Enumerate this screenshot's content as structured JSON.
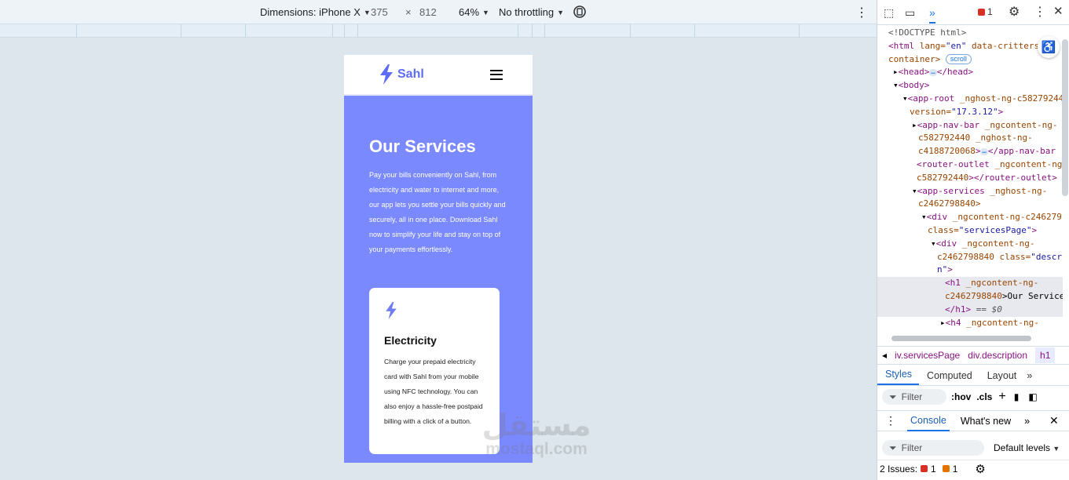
{
  "device_toolbar": {
    "dimensions_label": "Dimensions: iPhone X",
    "width": "375",
    "times": "×",
    "height": "812",
    "zoom": "64%",
    "throttling": "No throttling"
  },
  "app": {
    "brand": "Sahl",
    "hero_title": "Our Services",
    "hero_text": "Pay your bills conveniently on Sahl, from electricity and water to internet and more, our app lets you settle your bills quickly and securely, all in one place. Download Sahl now to simplify your life and stay on top of your payments effortlessly.",
    "card_title": "Electricity",
    "card_text": "Charge your prepaid electricity card with Sahl from your mobile using NFC technology. You can also enjoy a hassle-free postpaid billing with a click of a button."
  },
  "watermark": {
    "arabic": "مستقل",
    "latin": "mostaql.com"
  },
  "devtools": {
    "issues_count": "1",
    "elements": {
      "l1": "<!DOCTYPE html>",
      "l2_tag": "<html",
      "l2_attr": " lang=",
      "l2_val": "\"en\"",
      "l2_attr2": " data-critters-",
      "l3": "container>",
      "l3_pill": "scroll",
      "l4_open": "<head>",
      "l4_close": "</head>",
      "l5": "<body>",
      "l6_tag": "<app-root",
      "l6_attr": " _nghost-ng-c58279244",
      "l7_attr": "version=",
      "l7_val": "\"17.3.12\"",
      "l7_end": ">",
      "l8_tag": "<app-nav-bar",
      "l8_attr": " _ngcontent-ng-",
      "l9": "c582792440 _nghost-ng-",
      "l10_attr": "c4188720068",
      "l10_close": "</app-nav-bar",
      "l11_tag": "<router-outlet",
      "l11_attr": " _ngcontent-ng",
      "l12_attr": "c582792440",
      "l12_close": "></router-outlet>",
      "l13_tag": "<app-services",
      "l13_attr": " _nghost-ng-",
      "l14": "c2462798840>",
      "l15_tag": "<div",
      "l15_attr": " _ngcontent-ng-c246279",
      "l16_attr": "class=",
      "l16_val": "\"servicesPage\"",
      "l16_end": ">",
      "l17_tag": "<div",
      "l17_attr": " _ngcontent-ng-",
      "l18_attr": "c2462798840 class=",
      "l18_val": "\"descr",
      "l19_val": "n\"",
      "l19_end": ">",
      "l20_tag": "<h1",
      "l20_attr": " _ngcontent-ng-",
      "l21_attr": "c2462798840",
      "l21_text": ">Our Service",
      "l22_tag": "</h1>",
      "l22_eq": " == $0",
      "l23_tag": "<h4",
      "l23_attr": " _ngcontent-ng-"
    },
    "breadcrumbs": [
      "iv.servicesPage",
      "div.description",
      "h1"
    ],
    "style_tabs": [
      "Styles",
      "Computed",
      "Layout"
    ],
    "filter_placeholder": "Filter",
    "hov": ":hov",
    "cls": ".cls",
    "console_tabs": [
      "Console",
      "What's new"
    ],
    "console_filter": "Filter",
    "default_levels": "Default levels",
    "issues_label": "2 Issues:",
    "issues_red": "1",
    "issues_orange": "1"
  }
}
